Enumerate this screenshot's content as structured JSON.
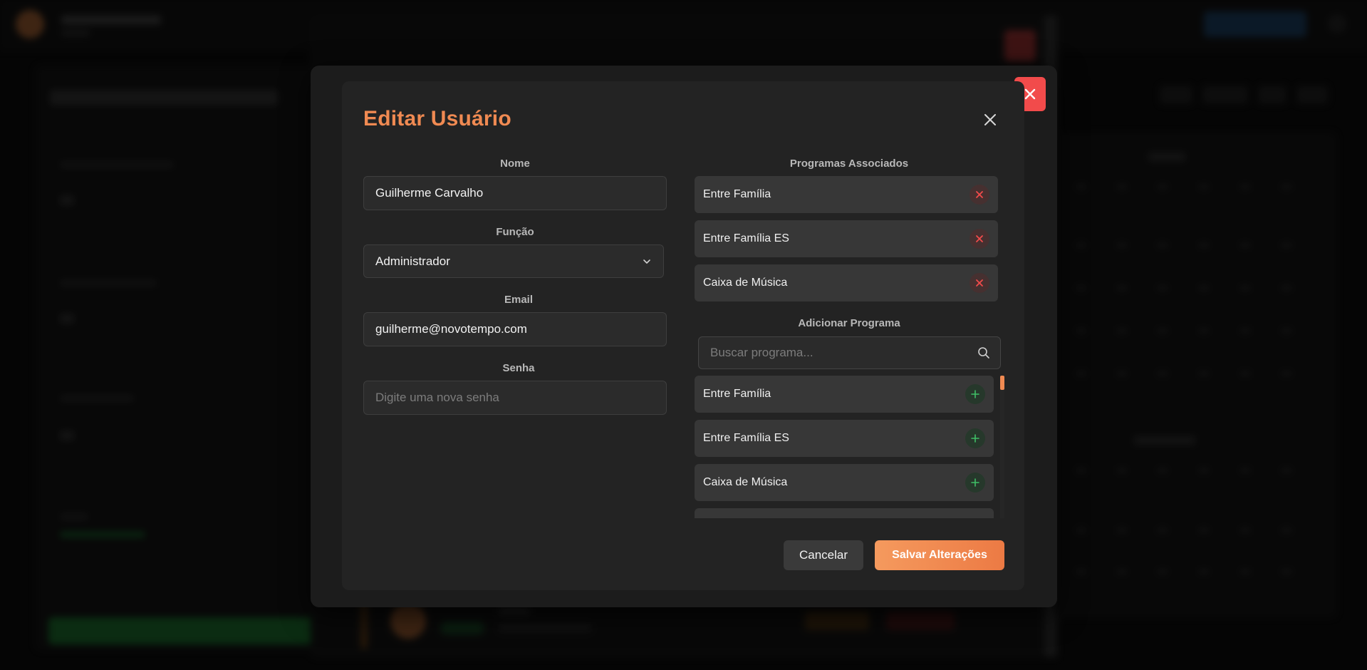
{
  "modal": {
    "title": "Editar Usuário",
    "fields": {
      "nome": {
        "label": "Nome",
        "value": "Guilherme Carvalho"
      },
      "funcao": {
        "label": "Função",
        "value": "Administrador"
      },
      "email": {
        "label": "Email",
        "value": "guilherme@novotempo.com"
      },
      "senha": {
        "label": "Senha",
        "placeholder": "Digite uma nova senha"
      }
    },
    "associated": {
      "label": "Programas Associados",
      "items": [
        {
          "name": "Entre Família"
        },
        {
          "name": "Entre Família ES"
        },
        {
          "name": "Caixa de Música"
        }
      ]
    },
    "add_program": {
      "label": "Adicionar Programa",
      "search_placeholder": "Buscar programa...",
      "items": [
        {
          "name": "Entre Família"
        },
        {
          "name": "Entre Família ES"
        },
        {
          "name": "Caixa de Música"
        },
        {
          "name": ""
        }
      ]
    },
    "buttons": {
      "cancel": "Cancelar",
      "save": "Salvar Alterações"
    }
  },
  "colors": {
    "accent": "#f08a52",
    "danger": "#f24b4b",
    "success": "#3fbf66"
  }
}
